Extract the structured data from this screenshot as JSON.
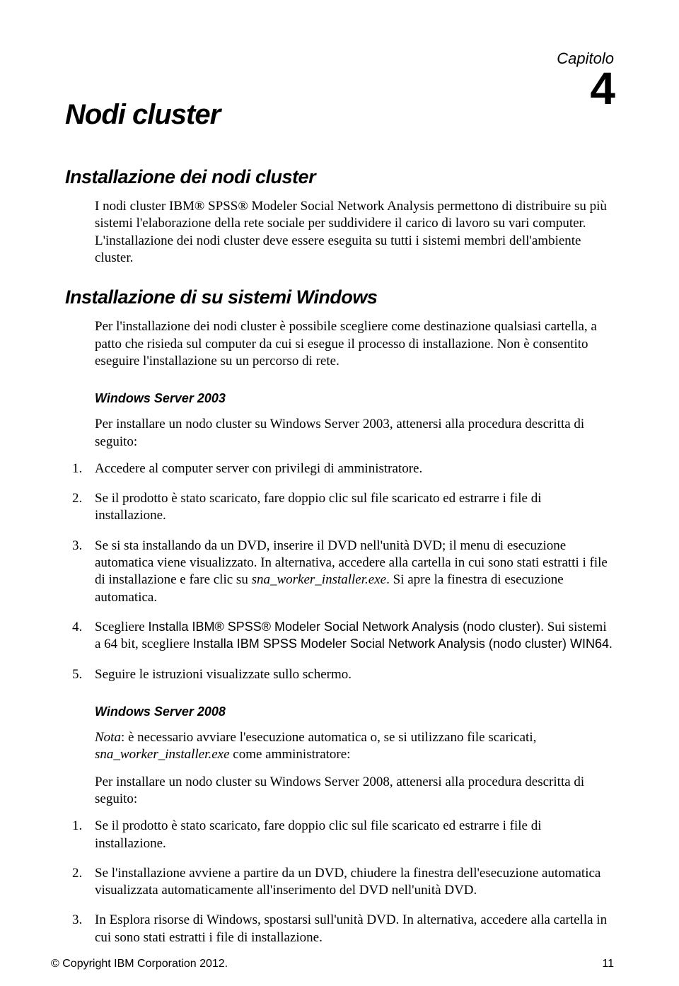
{
  "chapter": {
    "label": "Capitolo",
    "number": "4"
  },
  "title": "Nodi cluster",
  "section1": {
    "heading": "Installazione dei nodi cluster",
    "para": "I nodi cluster IBM® SPSS® Modeler Social Network Analysis permettono di distribuire su più sistemi l'elaborazione della rete sociale per suddividere il carico di lavoro su vari computer. L'installazione dei nodi cluster deve essere eseguita su tutti i sistemi membri dell'ambiente cluster."
  },
  "section2": {
    "heading": "Installazione di su sistemi Windows",
    "para": "Per l'installazione dei nodi cluster è possibile scegliere come destinazione qualsiasi cartella, a patto che risieda sul computer da cui si esegue il processo di installazione. Non è consentito eseguire l'installazione su un percorso di rete."
  },
  "ws2003": {
    "heading": "Windows Server 2003",
    "intro": "Per installare un nodo cluster su Windows Server 2003, attenersi alla procedura descritta di seguito:",
    "items": [
      {
        "n": "1.",
        "t": "Accedere al computer server con privilegi di amministratore."
      },
      {
        "n": "2.",
        "t": "Se il prodotto è stato scaricato, fare doppio clic sul file scaricato ed estrarre i file di installazione."
      },
      {
        "n": "3.",
        "t_a": "Se si sta installando da un DVD, inserire il DVD nell'unità DVD; il menu di esecuzione automatica viene visualizzato. In alternativa, accedere alla cartella in cui sono stati estratti i file di installazione e fare clic su ",
        "t_file": "sna_worker_installer.exe",
        "t_b": ". Si apre la finestra di esecuzione automatica."
      },
      {
        "n": "4.",
        "t_a": "Scegliere ",
        "t_sans1": "Installa IBM® SPSS® Modeler Social Network Analysis (nodo cluster)",
        "t_b": ". Sui sistemi a 64 bit, scegliere ",
        "t_sans2": "Installa IBM SPSS Modeler Social Network Analysis (nodo cluster) WIN64",
        "t_c": "."
      },
      {
        "n": "5.",
        "t": "Seguire le istruzioni visualizzate sullo schermo."
      }
    ]
  },
  "ws2008": {
    "heading": "Windows Server 2008",
    "nota_label": "Nota",
    "nota_a": ": è necessario avviare l'esecuzione automatica o, se si utilizzano file scaricati, ",
    "nota_file": "sna_worker_installer.exe",
    "nota_b": " come amministratore:",
    "intro": "Per installare un nodo cluster su Windows Server 2008, attenersi alla procedura descritta di seguito:",
    "items": [
      {
        "n": "1.",
        "t": "Se il prodotto è stato scaricato, fare doppio clic sul file scaricato ed estrarre i file di installazione."
      },
      {
        "n": "2.",
        "t": "Se l'installazione avviene a partire da un DVD, chiudere la finestra dell'esecuzione automatica visualizzata automaticamente all'inserimento del DVD nell'unità DVD."
      },
      {
        "n": "3.",
        "t": "In Esplora risorse di Windows, spostarsi sull'unità DVD. In alternativa, accedere alla cartella in cui sono stati estratti i file di installazione."
      }
    ]
  },
  "footer": {
    "copyright": "© Copyright IBM Corporation 2012.",
    "page": "11"
  }
}
